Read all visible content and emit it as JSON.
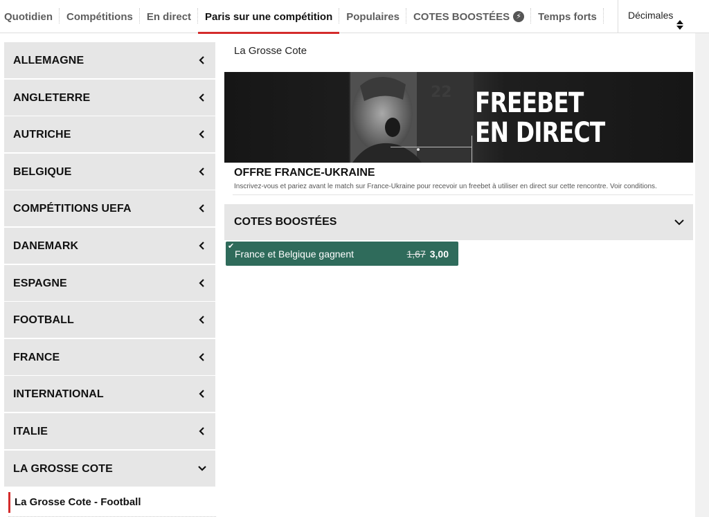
{
  "nav": {
    "tabs": [
      {
        "label": "Quotidien"
      },
      {
        "label": "Compétitions"
      },
      {
        "label": "En direct"
      },
      {
        "label": "Paris sur une compétition",
        "active": true
      },
      {
        "label": "Populaires"
      },
      {
        "label": "COTES BOOSTÉES"
      },
      {
        "label": "Temps forts"
      }
    ],
    "odds_format": "Décimales"
  },
  "sidebar": {
    "items": [
      {
        "label": "Allemagne"
      },
      {
        "label": "Angleterre"
      },
      {
        "label": "Autriche"
      },
      {
        "label": "Belgique"
      },
      {
        "label": "Compétitions UEFA"
      },
      {
        "label": "Danemark"
      },
      {
        "label": "Espagne"
      },
      {
        "label": "Football"
      },
      {
        "label": "France"
      },
      {
        "label": "International"
      },
      {
        "label": "Italie"
      },
      {
        "label": "La Grosse Cote",
        "expanded": true
      }
    ],
    "sub_item": "La Grosse Cote - Football"
  },
  "main": {
    "title": "La Grosse Cote",
    "banner": {
      "line1": "FREEBET",
      "line2": "EN DIRECT"
    },
    "promo": {
      "title": "OFFRE FRANCE-UKRAINE",
      "description": "Inscrivez-vous et pariez avant le match sur France-Ukraine pour recevoir un freebet à utiliser en direct sur cette rencontre. Voir conditions."
    },
    "boosted": {
      "header": "COTES BOOSTÉES",
      "bet": {
        "selection": "France et Belgique gagnent",
        "old_odds": "1,67",
        "new_odds": "3,00"
      }
    }
  },
  "colors": {
    "accent_red": "#d42c2c",
    "bet_green": "#2f6b5b",
    "panel_grey": "#e6e6e6"
  }
}
